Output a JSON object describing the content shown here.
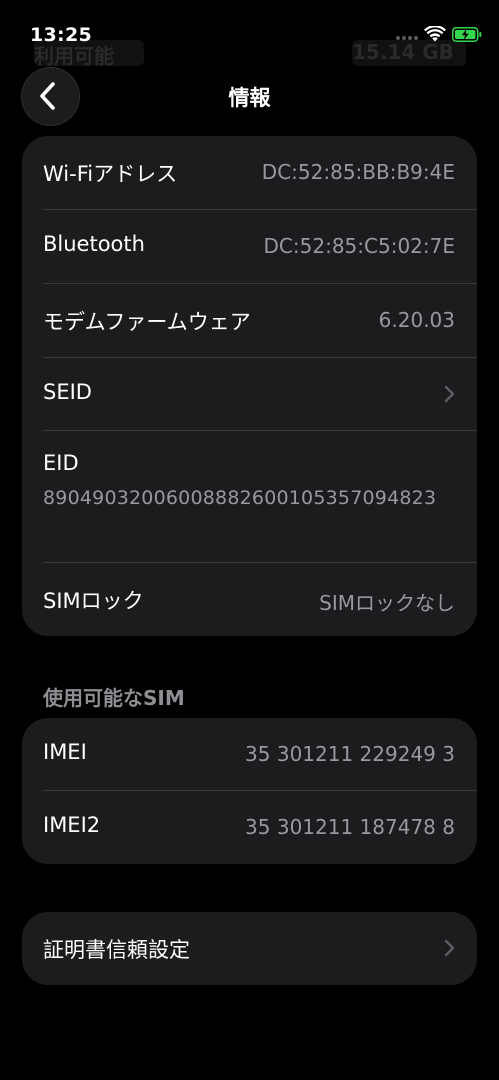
{
  "status_bar": {
    "time": "13:25",
    "ghost_left": "利用可能",
    "ghost_right": "15.14 GB",
    "battery_color": "#32d74b"
  },
  "nav": {
    "back_icon": "chevron-left-icon",
    "title": "情報"
  },
  "info_card": {
    "rows": [
      {
        "label": "Wi-Fiアドレス",
        "value": "DC:52:85:BB:B9:4E"
      },
      {
        "label": "Bluetooth",
        "value": "DC:52:85:C5:02:7E"
      },
      {
        "label": "モデムファームウェア",
        "value": "6.20.03"
      },
      {
        "label": "SEID",
        "value": ""
      },
      {
        "label": "EID",
        "value": "89049032006008882600105357094823"
      },
      {
        "label": "SIMロック",
        "value": "SIMロックなし"
      }
    ]
  },
  "sim_section": {
    "header": "使用可能なSIM",
    "rows": [
      {
        "label": "IMEI",
        "value": "35 301211 229249 3"
      },
      {
        "label": "IMEI2",
        "value": "35 301211 187478 8"
      }
    ]
  },
  "certificate_card": {
    "label": "証明書信頼設定"
  },
  "colors": {
    "background": "#000000",
    "card": "#1c1c1e",
    "secondary_text": "#98989f",
    "separator": "#38383a"
  }
}
